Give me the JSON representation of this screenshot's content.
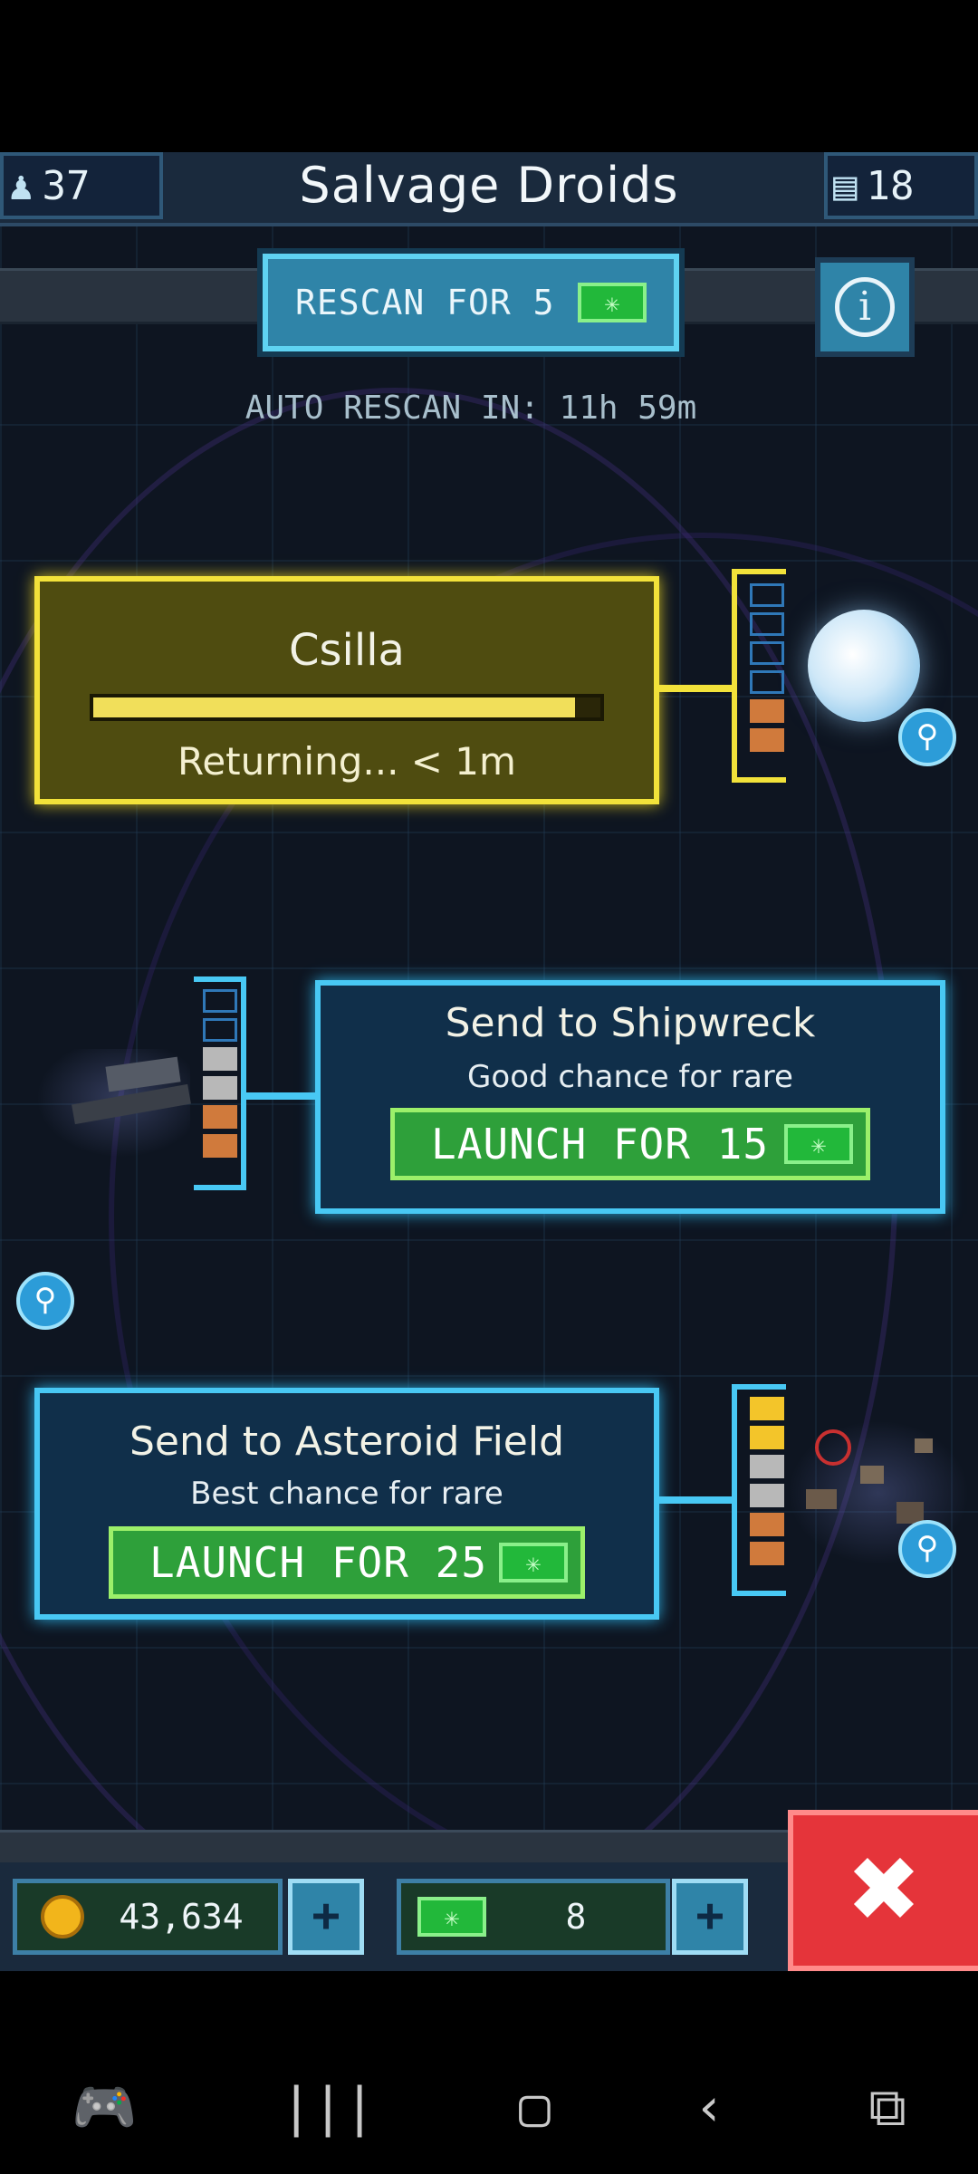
{
  "header": {
    "title": "Salvage Droids",
    "crew_count": "37",
    "card_count": "18",
    "crew_icon": "person-icon",
    "card_icon": "card-icon"
  },
  "rescan": {
    "label": "RESCAN FOR 5",
    "auto_text": "AUTO RESCAN IN: 11h 59m",
    "info_icon": "i"
  },
  "missions": [
    {
      "name": "Csilla",
      "status": "Returning... < 1m",
      "progress": 0.95,
      "state": "returning",
      "target": "planet"
    },
    {
      "name": "Send to Shipwreck",
      "subtitle": "Good chance for rare",
      "launch_label": "LAUNCH FOR 15",
      "target": "shipwreck"
    },
    {
      "name": "Send to Asteroid Field",
      "subtitle": "Best chance for rare",
      "launch_label": "LAUNCH FOR 25",
      "target": "asteroid-field"
    }
  ],
  "footer": {
    "coins": "43,634",
    "gems": "8",
    "plus_symbol": "+",
    "close_symbol": "✖"
  },
  "colors": {
    "accent_blue": "#48c8f4",
    "accent_yellow": "#f2e23a",
    "launch_green": "#2ea03a",
    "close_red": "#e5343a"
  },
  "android_nav": [
    "game-launcher-icon",
    "recents-icon",
    "home-icon",
    "back-icon",
    "screenshot-icon"
  ]
}
